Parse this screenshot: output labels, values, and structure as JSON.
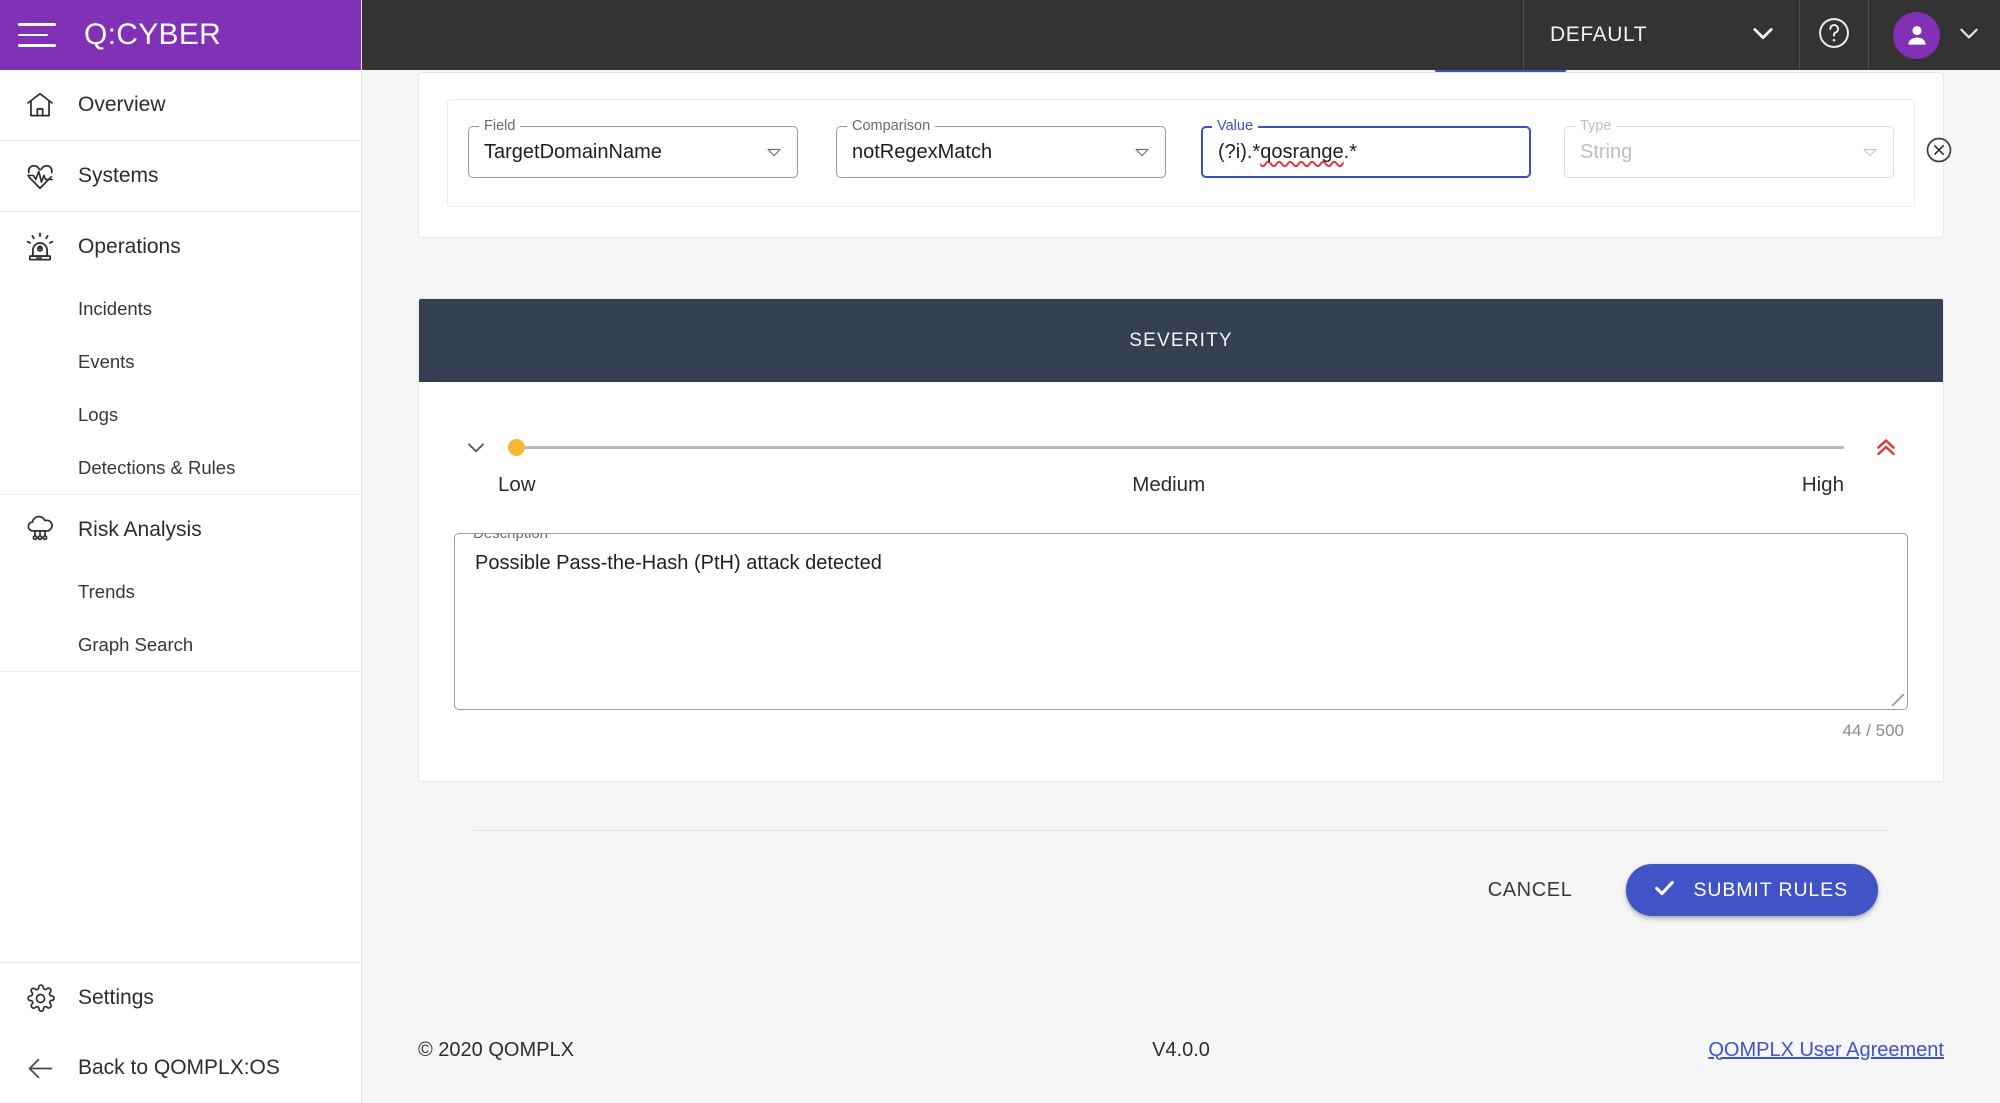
{
  "brand": {
    "title": "Q:CYBER",
    "menu_icon": "hamburger-menu-icon"
  },
  "topbar": {
    "tenant": "DEFAULT",
    "tenant_caret_icon": "chevron-down-icon",
    "help_icon": "help-circle-icon",
    "user_icon": "user-avatar-icon",
    "user_caret_icon": "chevron-down-icon"
  },
  "sidebar": {
    "items": [
      {
        "label": "Overview",
        "icon": "home-icon"
      },
      {
        "label": "Systems",
        "icon": "heartbeat-icon"
      },
      {
        "label": "Operations",
        "icon": "siren-icon"
      }
    ],
    "operations_sub": [
      {
        "label": "Incidents"
      },
      {
        "label": "Events"
      },
      {
        "label": "Logs"
      },
      {
        "label": "Detections & Rules"
      }
    ],
    "risk": {
      "label": "Risk Analysis",
      "icon": "cloud-network-icon"
    },
    "risk_sub": [
      {
        "label": "Trends"
      },
      {
        "label": "Graph Search"
      }
    ],
    "settings": {
      "label": "Settings",
      "icon": "gear-icon"
    },
    "back": {
      "label": "Back to QOMPLX:OS",
      "icon": "arrow-left-icon"
    }
  },
  "criteria": {
    "field": {
      "legend": "Field",
      "value": "TargetDomainName",
      "caret_icon": "caret-down-icon"
    },
    "comparison": {
      "legend": "Comparison",
      "value": "notRegexMatch",
      "caret_icon": "caret-down-icon"
    },
    "value": {
      "legend": "Value",
      "value_prefix": "(?i).*",
      "value_spell": "qosrange",
      "value_suffix": ".*",
      "full": "(?i).*qosrange.*"
    },
    "type": {
      "legend": "Type",
      "value": "String",
      "caret_icon": "caret-down-icon"
    },
    "delete_icon": "remove-circle-icon"
  },
  "severity": {
    "header": "SEVERITY",
    "collapse_icon": "chevron-down-icon",
    "escalate_icon": "double-chevron-up-icon",
    "labels": {
      "low": "Low",
      "medium": "Medium",
      "high": "High"
    },
    "selected": "Low",
    "thumb_color": "#f7b733",
    "escalate_color": "#e03b34"
  },
  "description": {
    "legend": "Description *",
    "value": "Possible Pass-the-Hash (PtH) attack detected",
    "char_count": "44 / 500"
  },
  "actions": {
    "cancel_label": "CANCEL",
    "submit_label": "SUBMIT RULES",
    "submit_icon": "check-icon",
    "submit_color": "#4054c8"
  },
  "footer": {
    "copyright": "© 2020 QOMPLX",
    "version": "V4.0.0",
    "agreement": "QOMPLX User Agreement"
  }
}
